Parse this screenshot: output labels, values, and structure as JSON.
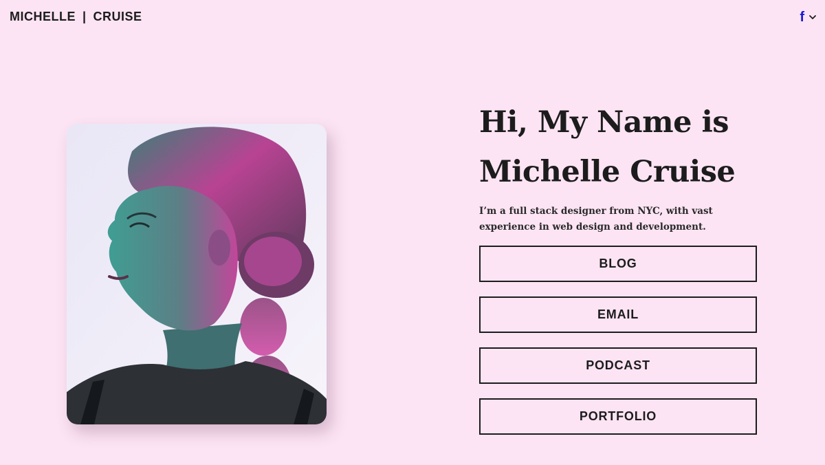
{
  "header": {
    "brand_first": "MICHELLE",
    "brand_separator": "|",
    "brand_last": "CRUISE",
    "social_icon": "facebook-icon",
    "social_glyph": "f",
    "menu_icon": "chevron-down-icon"
  },
  "hero": {
    "headline_line1": "Hi, My Name is",
    "headline_line2": "Michelle Cruise",
    "tagline": "I’m a full stack designer from NYC, with vast experience in web design and development."
  },
  "buttons": [
    {
      "label": "BLOG"
    },
    {
      "label": "EMAIL"
    },
    {
      "label": "PODCAST"
    },
    {
      "label": "PORTFOLIO"
    }
  ],
  "colors": {
    "background": "#fce4f4",
    "text": "#1c1c1c",
    "facebook": "#1a1ad0",
    "portrait_pink": "#d23a9c",
    "portrait_teal": "#2f8f88"
  }
}
